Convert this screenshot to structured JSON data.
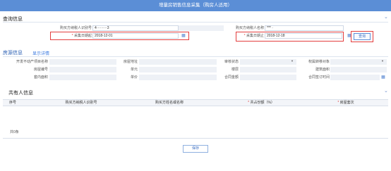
{
  "window": {
    "title": "增量房销售信息采集（购房人适用）"
  },
  "query": {
    "section_title": "查询信息",
    "buyer_tax_id_label": "购买方纳税人识别号",
    "buyer_tax_id_value": "4·········3",
    "buyer_name_label": "购买方纳税人名称",
    "buyer_name_value": "*** ·",
    "start_date_label": "采集日期起",
    "start_date_value": "2018-12-01",
    "end_date_label": "采集日期止",
    "end_date_value": "2018-12-18",
    "query_button": "查询"
  },
  "house": {
    "tab_active": "房源信息",
    "tab_link": "显示详情",
    "labels": {
      "project_name": "开发不动产项目名称",
      "address": "房屋地址",
      "audit_status": "审核状态",
      "transfer_object": "权属转移对象",
      "house_number": "房屋编号",
      "unit": "单元",
      "floor": "楼层",
      "building_area": "建筑面积",
      "inner_area": "套内面积",
      "unit_price": "单价",
      "contract_amount": "合同金额",
      "contract_date": "合同签订时间"
    }
  },
  "coowner": {
    "section_title": "共有人信息",
    "columns": [
      "序号",
      "购买方纳税人识别号",
      "购买方姓名或名称",
      "共占份额（%）",
      "房屋套次"
    ],
    "required_cols": [
      false,
      false,
      false,
      true,
      true
    ],
    "footer": "共0条"
  },
  "actions": {
    "save": "保存"
  },
  "colors": {
    "titlebar": "#5b8ed6",
    "required": "#e23b3b",
    "highlight_box": "#e33d3d"
  }
}
